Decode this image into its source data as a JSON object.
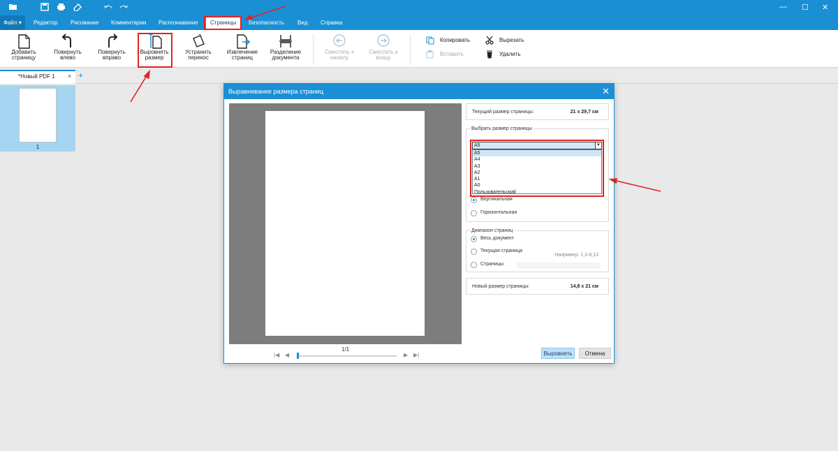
{
  "app": {
    "title": "",
    "menu": [
      "Файл",
      "Редактор",
      "Рисование",
      "Комментарии",
      "Распознавание",
      "Страницы",
      "Безопасность",
      "Вид",
      "Справка"
    ],
    "active_menu": "Страницы",
    "accent": "#1a8fd4",
    "highlight": "#e02323"
  },
  "ribbon": {
    "add_page": "Добавить страницу",
    "rotate_left": "Повернуть влево",
    "rotate_right": "Повернуть вправо",
    "align_size": "Выровнять размер",
    "fix_skew": "Устранить перекос",
    "extract_pages": "Извлечение страниц",
    "split_doc": "Разделение документа",
    "move_start": "Сместить к началу",
    "move_end": "Сместить к концу",
    "copy": "Копировать",
    "paste": "Вставить",
    "cut": "Вырезать",
    "delete": "Удалить"
  },
  "tabs": {
    "doc_tab": "*Новый PDF 1",
    "close": "✕",
    "add": "+"
  },
  "thumbnails": {
    "page_number": "1"
  },
  "dialog": {
    "title": "Выравнивание размера страниц",
    "close": "✕",
    "current_label": "Текущий размер страницы:",
    "current_value": "21 x 29,7 см",
    "choose_label": "Выбрать размер страницы",
    "selected": "A5",
    "options": [
      "A5",
      "A4",
      "A3",
      "A2",
      "A1",
      "A0",
      "Пользовательский"
    ],
    "orient_vertical": "Вертикальная",
    "orient_horizontal": "Горизонтальная",
    "range_label": "Диапазон страниц",
    "range_all": "Весь документ",
    "range_current": "Текущая страница",
    "range_pages": "Страницы:",
    "range_hint": "Например: 1,3-8,13",
    "new_label": "Новый размер страницы:",
    "new_value": "14,8 x 21 см",
    "page_counter": "1/1",
    "btn_apply": "Выровнять",
    "btn_cancel": "Отмена"
  }
}
